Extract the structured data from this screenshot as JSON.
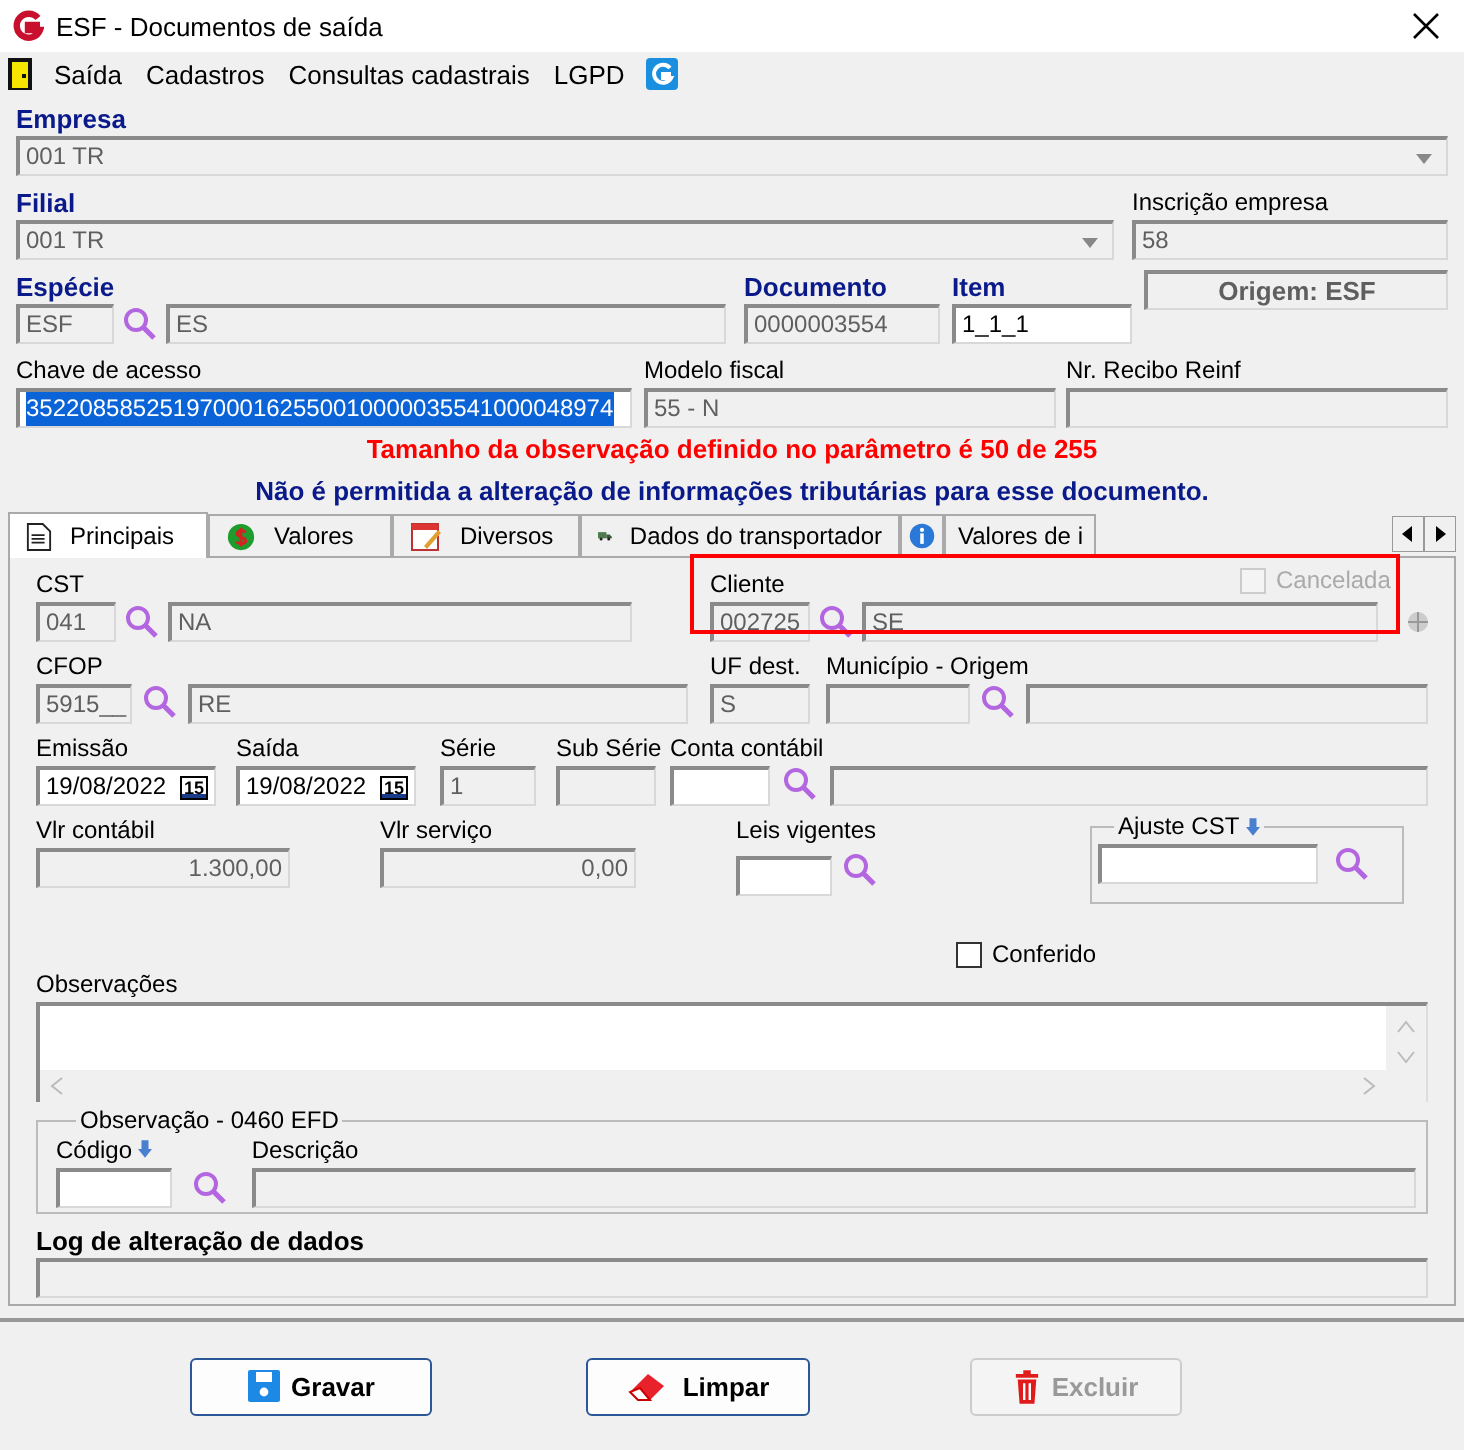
{
  "window": {
    "title": "ESF - Documentos de saída"
  },
  "menu": [
    {
      "label": "Saída"
    },
    {
      "label": "Cadastros"
    },
    {
      "label": "Consultas cadastrais"
    },
    {
      "label": "LGPD"
    }
  ],
  "header": {
    "empresa": {
      "label": "Empresa",
      "value": "001 TR",
      "editable": false
    },
    "filial": {
      "label": "Filial",
      "value": "001 TR",
      "editable": false
    },
    "inscricao": {
      "label": "Inscrição empresa",
      "value": "58",
      "editable": false
    },
    "especie": {
      "label": "Espécie",
      "code": "ESF",
      "name": "ES",
      "editable": false
    },
    "documento": {
      "label": "Documento",
      "value": "0000003554",
      "editable": false
    },
    "item": {
      "label": "Item",
      "value": "1_1_1",
      "editable": true
    },
    "origem": "Origem: ESF",
    "chave": {
      "label": "Chave de acesso",
      "value": "35220858525197000162550010000035541000048974",
      "selected": true
    },
    "modelo": {
      "label": "Modelo fiscal",
      "value": "55 - N",
      "editable": false
    },
    "recibo": {
      "label": "Nr. Recibo Reinf",
      "editable": false
    }
  },
  "messages": [
    {
      "text": "Tamanho da observação definido no parâmetro é 50 de 255",
      "kind": "warning"
    },
    {
      "text": "Não é permitida a alteração de informações tributárias para esse documento.",
      "kind": "info"
    }
  ],
  "tabs": [
    {
      "label": "Principais",
      "selected": true
    },
    {
      "label": "Valores",
      "selected": false
    },
    {
      "label": "Diversos",
      "selected": false
    },
    {
      "label": "Dados do transportador",
      "selected": false
    },
    {
      "selected": false
    },
    {
      "label": "Valores de i",
      "selected": false
    }
  ],
  "principais": {
    "cst": {
      "label": "CST",
      "code": "041",
      "name": "NA",
      "editable": false
    },
    "cliente": {
      "label": "Cliente",
      "code": "002725",
      "name": "SE",
      "editable": false,
      "highlighted": true
    },
    "cancelada": {
      "label": "Cancelada",
      "checked": false,
      "disabled": true
    },
    "cfop": {
      "label": "CFOP",
      "code": "5915__",
      "name": "RE",
      "editable": false
    },
    "uf": {
      "label": "UF dest.",
      "value": "S",
      "editable": false
    },
    "municipio": {
      "label": "Município - Origem",
      "editable": false
    },
    "emissao": {
      "label": "Emissão",
      "value": "19/08/2022",
      "picker": "15",
      "editable": true
    },
    "saida": {
      "label": "Saída",
      "value": "19/08/2022",
      "picker": "15",
      "editable": true
    },
    "serie": {
      "label": "Série",
      "value": "1",
      "editable": false
    },
    "subserie": {
      "label": "Sub Série",
      "editable": false
    },
    "conta": {
      "label": "Conta contábil",
      "editable": true
    },
    "vlr_contabil": {
      "label": "Vlr contábil",
      "value": "1.300,00",
      "editable": false
    },
    "vlr_servico": {
      "label": "Vlr serviço",
      "value": "0,00",
      "editable": false
    },
    "leis": {
      "label": "Leis vigentes",
      "editable": true
    },
    "ajuste": {
      "label": "Ajuste CST",
      "editable": true
    },
    "conferido": {
      "label": "Conferido",
      "checked": false,
      "disabled": false
    },
    "observacoes": {
      "label": "Observações",
      "editable": true
    },
    "efd": {
      "title": "Observação - 0460 EFD",
      "codigo_label": "Código",
      "descricao_label": "Descrição"
    },
    "log": {
      "label": "Log de alteração de dados",
      "editable": false
    }
  },
  "buttons": [
    {
      "label": "Gravar",
      "kind": "save",
      "enabled": true
    },
    {
      "label": "Limpar",
      "kind": "clear",
      "enabled": true
    },
    {
      "label": "Excluir",
      "kind": "delete",
      "enabled": false
    }
  ]
}
